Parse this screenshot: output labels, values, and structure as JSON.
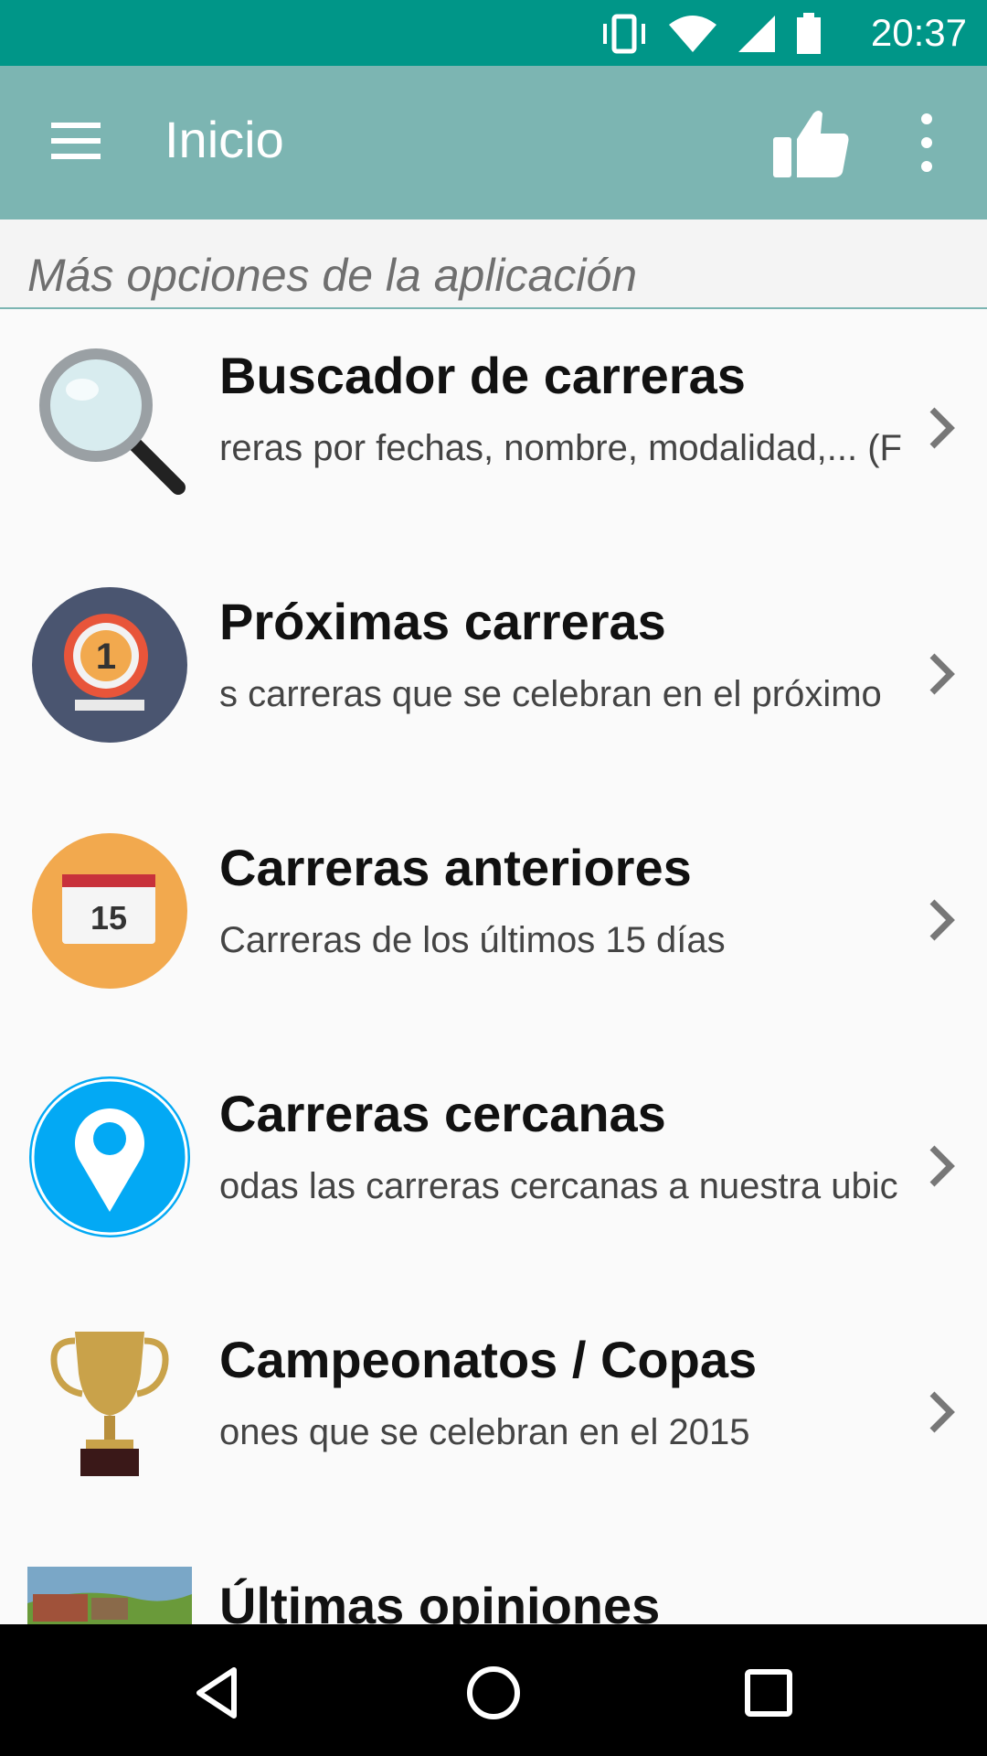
{
  "status_bar": {
    "time": "20:37",
    "icons": [
      "vibrate-icon",
      "wifi-icon",
      "signal-icon",
      "battery-icon"
    ]
  },
  "app_bar": {
    "title": "Inicio",
    "icons": [
      "menu-icon",
      "thumbs-up-icon",
      "more-vert-icon"
    ]
  },
  "section": {
    "header": "Más opciones de la aplicación"
  },
  "menu": [
    {
      "title": "Buscador de carreras",
      "subtitle": "reras por fechas, nombre, modalidad,... (F",
      "icon": "magnifier-icon"
    },
    {
      "title": "Próximas carreras",
      "subtitle": "s carreras que se celebran en el próximo",
      "icon": "medal-icon"
    },
    {
      "title": "Carreras anteriores",
      "subtitle": "Carreras de los últimos 15 días",
      "icon": "calendar-icon",
      "calendar_day": "15"
    },
    {
      "title": "Carreras cercanas",
      "subtitle": "odas las carreras cercanas a nuestra ubic",
      "icon": "location-pin-icon"
    },
    {
      "title": "Campeonatos / Copas",
      "subtitle": "ones que se celebran en el 2015",
      "icon": "trophy-icon"
    },
    {
      "title": "Últimas opiniones",
      "subtitle": "",
      "icon": "landscape-photo-icon"
    }
  ],
  "colors": {
    "status_bar": "#009688",
    "app_bar": "#7cb5b2",
    "medal_bg": "#4a5570",
    "calendar_bg": "#f2a94e",
    "pin_bg": "#03a9f4"
  },
  "nav_bar": {
    "icons": [
      "back-icon",
      "home-icon",
      "recents-icon"
    ]
  }
}
